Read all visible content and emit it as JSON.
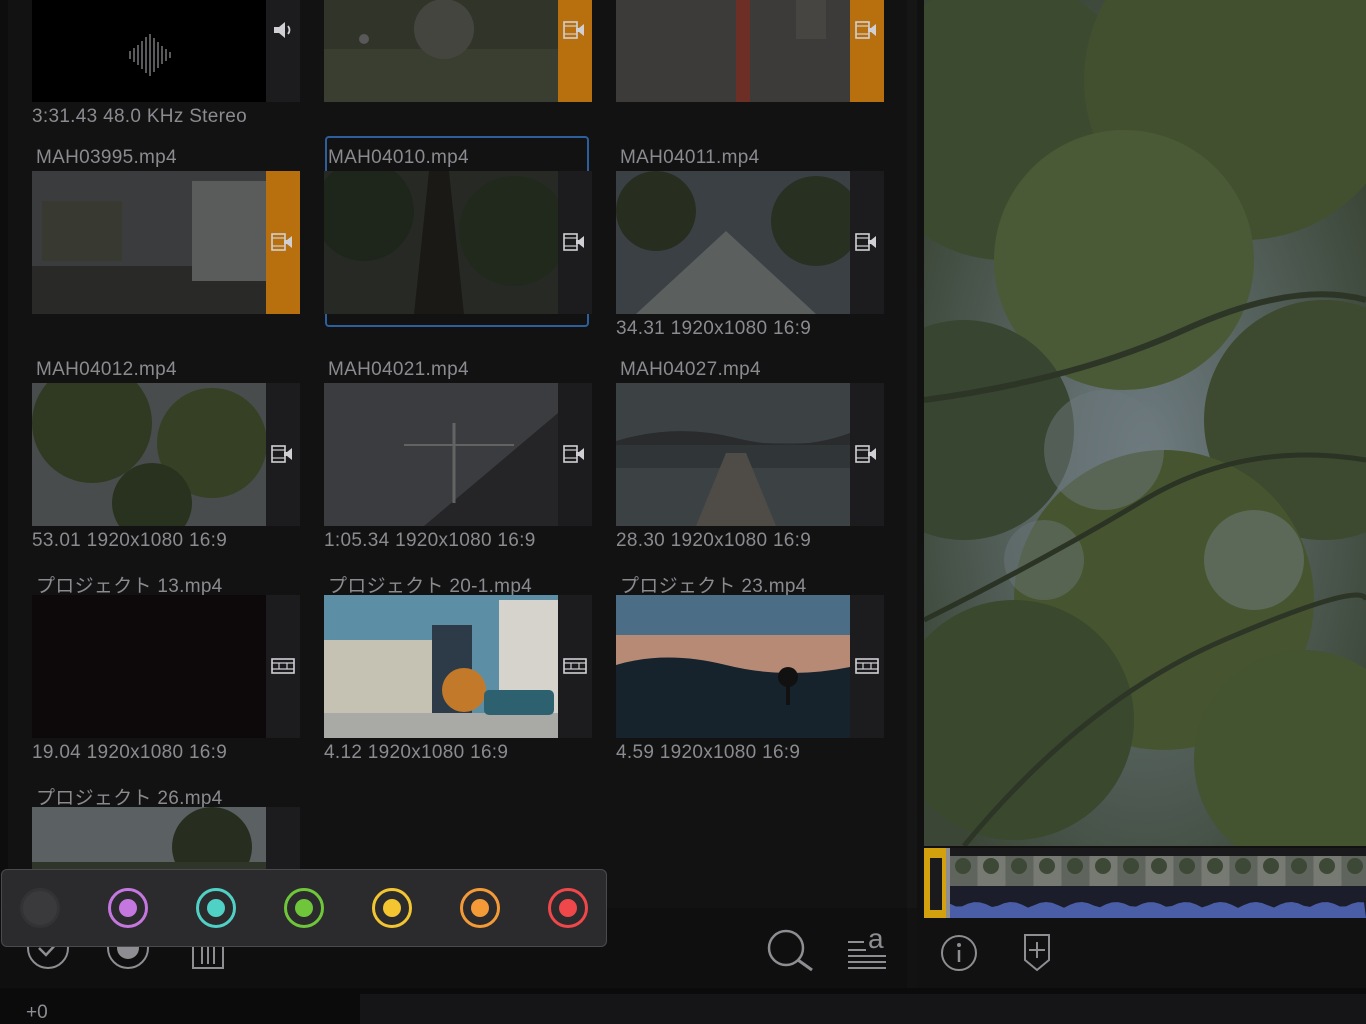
{
  "browser": {
    "clips": [
      {
        "name": "",
        "meta": "3:31.43  48.0 KHz  Stereo",
        "kind": "audio",
        "icon": "speaker-icon",
        "tagged": false
      },
      {
        "name": "",
        "meta": "",
        "kind": "video-audio",
        "icon": "video-audio-icon",
        "tagged": true
      },
      {
        "name": "",
        "meta": "",
        "kind": "video-audio",
        "icon": "video-audio-icon",
        "tagged": true
      },
      {
        "name": "MAH03995.mp4",
        "meta": "",
        "kind": "video-audio",
        "icon": "video-audio-icon",
        "tagged": true
      },
      {
        "name": "MAH04010.mp4",
        "meta": "",
        "kind": "video-audio",
        "icon": "video-audio-icon",
        "tagged": false,
        "selected": true
      },
      {
        "name": "MAH04011.mp4",
        "meta": "34.31  1920x1080  16:9",
        "kind": "video-audio",
        "icon": "video-audio-icon",
        "tagged": false
      },
      {
        "name": "MAH04012.mp4",
        "meta": "53.01  1920x1080  16:9",
        "kind": "video-audio",
        "icon": "video-audio-icon",
        "tagged": false
      },
      {
        "name": "MAH04021.mp4",
        "meta": "1:05.34  1920x1080  16:9",
        "kind": "video-audio",
        "icon": "video-audio-icon",
        "tagged": false
      },
      {
        "name": "MAH04027.mp4",
        "meta": "28.30  1920x1080  16:9",
        "kind": "video-audio",
        "icon": "video-audio-icon",
        "tagged": false
      },
      {
        "name": "プロジェクト 13.mp4",
        "meta": "19.04  1920x1080  16:9",
        "kind": "video",
        "icon": "film-icon",
        "tagged": false
      },
      {
        "name": "プロジェクト 20-1.mp4",
        "meta": "4.12  1920x1080  16:9",
        "kind": "video",
        "icon": "film-icon",
        "tagged": false
      },
      {
        "name": "プロジェクト 23.mp4",
        "meta": "4.59  1920x1080  16:9",
        "kind": "video",
        "icon": "film-icon",
        "tagged": false
      },
      {
        "name": "プロジェクト 26.mp4",
        "meta": "",
        "kind": "video",
        "icon": "film-icon",
        "tagged": false
      }
    ]
  },
  "palette": {
    "colors": [
      {
        "name": "none",
        "hex": "#3a3a3d",
        "ring": "#333336"
      },
      {
        "name": "purple",
        "hex": "#c577e0",
        "ring": "#c577e0"
      },
      {
        "name": "teal",
        "hex": "#4fd1c5",
        "ring": "#4fd1c5"
      },
      {
        "name": "green",
        "hex": "#6fc63a",
        "ring": "#6fc63a"
      },
      {
        "name": "yellow",
        "hex": "#f3c531",
        "ring": "#f3c531"
      },
      {
        "name": "orange",
        "hex": "#f49a36",
        "ring": "#f49a36"
      },
      {
        "name": "red",
        "hex": "#f0474b",
        "ring": "#f0474b"
      }
    ]
  },
  "toolbar": {
    "left_icons": [
      "checkmark-icon",
      "record-icon",
      "trash-icon"
    ],
    "right_icons": [
      "search-icon",
      "sort-text-icon"
    ]
  },
  "viewer": {
    "controls": [
      "info-icon",
      "add-marker-icon"
    ]
  },
  "status": {
    "offset": "+0"
  },
  "colors": {
    "accent_orange": "#b8700f",
    "selection_blue": "#2c5f9c",
    "waveform_blue": "#4a5ea8",
    "playhead_yellow": "#d4a10e"
  }
}
